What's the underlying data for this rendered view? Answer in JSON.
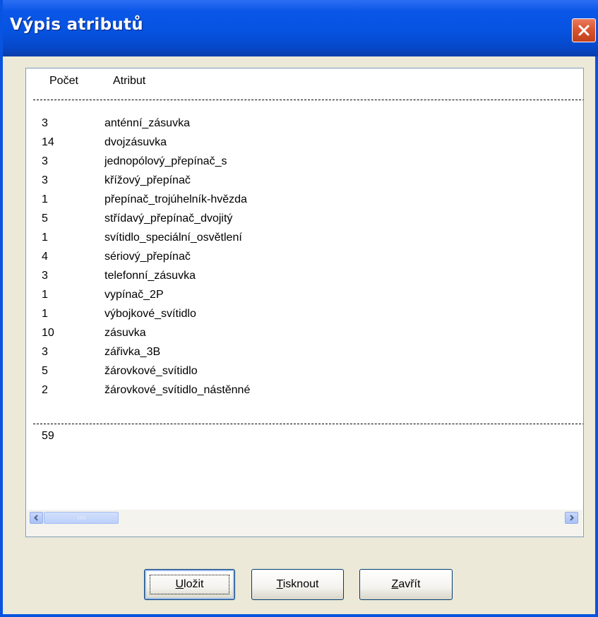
{
  "window": {
    "title": "Výpis atributů"
  },
  "list": {
    "col_count_header": "Počet",
    "col_attribute_header": "Atribut",
    "rows": [
      {
        "count": "3",
        "attribute": "anténní_zásuvka"
      },
      {
        "count": "14",
        "attribute": "dvojzásuvka"
      },
      {
        "count": "3",
        "attribute": "jednopólový_přepínač_s"
      },
      {
        "count": "3",
        "attribute": "křížový_přepínač"
      },
      {
        "count": "1",
        "attribute": "přepínač_trojúhelník-hvězda"
      },
      {
        "count": "5",
        "attribute": "střídavý_přepínač_dvojitý"
      },
      {
        "count": "1",
        "attribute": "svítidlo_speciální_osvětlení"
      },
      {
        "count": "4",
        "attribute": "sériový_přepínač"
      },
      {
        "count": "3",
        "attribute": "telefonní_zásuvka"
      },
      {
        "count": "1",
        "attribute": "vypínač_2P"
      },
      {
        "count": "1",
        "attribute": "výbojkové_svítidlo"
      },
      {
        "count": "10",
        "attribute": "zásuvka"
      },
      {
        "count": "3",
        "attribute": "zářivka_3B"
      },
      {
        "count": "5",
        "attribute": "žárovkové_svítidlo"
      },
      {
        "count": "2",
        "attribute": "žárovkové_svítidlo_nástěnné"
      }
    ],
    "total": "59"
  },
  "buttons": {
    "save": {
      "mnemonic": "U",
      "rest": "ložit"
    },
    "print": {
      "mnemonic": "T",
      "rest": "isknout"
    },
    "close": {
      "mnemonic": "Z",
      "rest": "avřít"
    }
  },
  "icons": {
    "close": "close-icon",
    "scroll_left": "arrow-left-icon",
    "scroll_right": "arrow-right-icon",
    "thumb_grip": "grip-icon"
  },
  "colors": {
    "titlebar": "#0653e1",
    "close_button": "#d9532e",
    "dialog_face": "#ece9d8"
  }
}
